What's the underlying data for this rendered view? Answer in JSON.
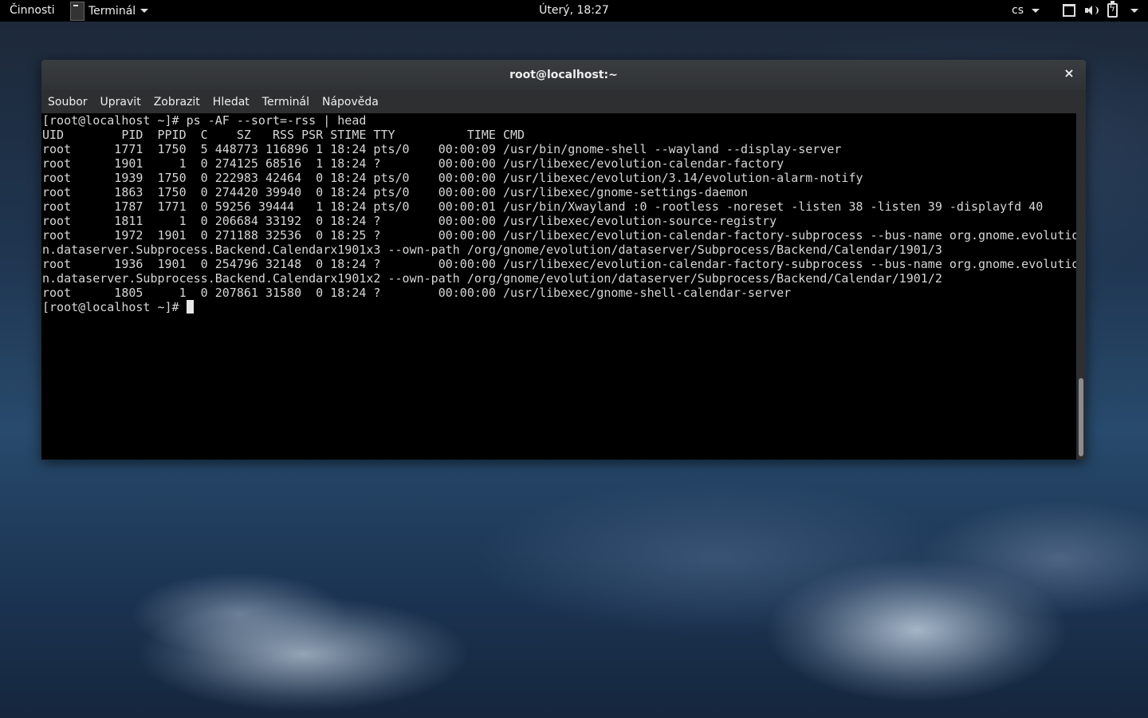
{
  "topbar": {
    "activities": "Činnosti",
    "app_menu": "Terminál",
    "clock": "Úterý, 18:27",
    "language": "cs"
  },
  "window": {
    "title": "root@localhost:~",
    "close_icon": "×",
    "menu": [
      "Soubor",
      "Upravit",
      "Zobrazit",
      "Hledat",
      "Terminál",
      "Nápověda"
    ]
  },
  "terminal": {
    "lines": [
      "[root@localhost ~]# ps -AF --sort=-rss | head",
      "UID        PID  PPID  C    SZ   RSS PSR STIME TTY          TIME CMD",
      "root      1771  1750  5 448773 116896 1 18:24 pts/0    00:00:09 /usr/bin/gnome-shell --wayland --display-server",
      "root      1901     1  0 274125 68516  1 18:24 ?        00:00:00 /usr/libexec/evolution-calendar-factory",
      "root      1939  1750  0 222983 42464  0 18:24 pts/0    00:00:00 /usr/libexec/evolution/3.14/evolution-alarm-notify",
      "root      1863  1750  0 274420 39940  0 18:24 pts/0    00:00:00 /usr/libexec/gnome-settings-daemon",
      "root      1787  1771  0 59256 39444   1 18:24 pts/0    00:00:01 /usr/bin/Xwayland :0 -rootless -noreset -listen 38 -listen 39 -displayfd 40",
      "root      1811     1  0 206684 33192  0 18:24 ?        00:00:00 /usr/libexec/evolution-source-registry",
      "root      1972  1901  0 271188 32536  0 18:25 ?        00:00:00 /usr/libexec/evolution-calendar-factory-subprocess --bus-name org.gnome.evolutio",
      "n.dataserver.Subprocess.Backend.Calendarx1901x3 --own-path /org/gnome/evolution/dataserver/Subprocess/Backend/Calendar/1901/3",
      "root      1936  1901  0 254796 32148  0 18:24 ?        00:00:00 /usr/libexec/evolution-calendar-factory-subprocess --bus-name org.gnome.evolutio",
      "n.dataserver.Subprocess.Backend.Calendarx1901x2 --own-path /org/gnome/evolution/dataserver/Subprocess/Backend/Calendar/1901/2",
      "root      1805     1  0 207861 31580  0 18:24 ?        00:00:00 /usr/libexec/gnome-shell-calendar-server"
    ],
    "prompt": "[root@localhost ~]# "
  }
}
